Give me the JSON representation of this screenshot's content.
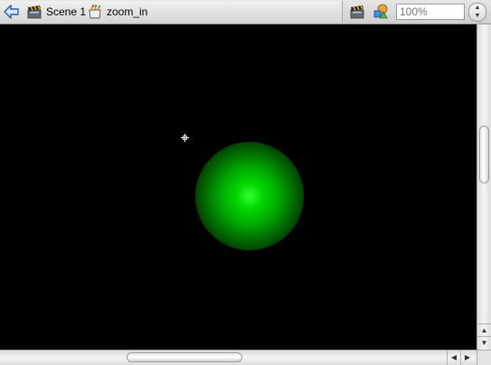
{
  "breadcrumb": {
    "scene_label": "Scene 1",
    "symbol_label": "zoom_in"
  },
  "zoom": {
    "value": "100%"
  },
  "icons": {
    "back": "back-arrow-icon",
    "scene": "clapperboard-icon",
    "symbol": "movieclip-symbol-icon",
    "edit_scene": "edit-scene-icon",
    "edit_symbol": "edit-symbol-icon",
    "crosshair": "registration-point-icon"
  },
  "stage": {
    "background": "#000000",
    "glow_color": "#33ff33"
  },
  "scrollbars": {
    "up_arrow": "▲",
    "down_arrow": "▼",
    "left_arrow": "◀",
    "right_arrow": "▶",
    "stepper_up": "▲",
    "stepper_down": "▼"
  }
}
